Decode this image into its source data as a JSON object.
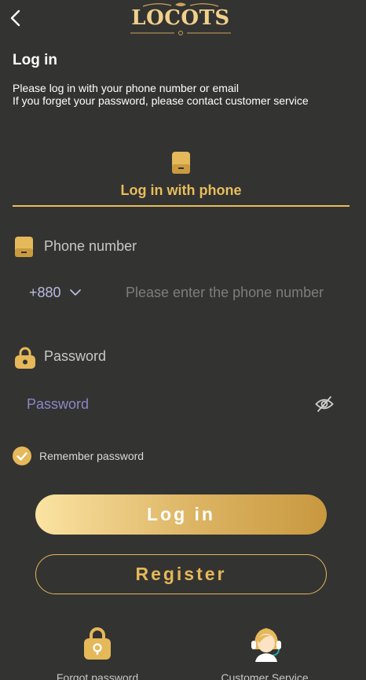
{
  "header": {
    "logo_text": "LOCOTS"
  },
  "title": "Log in",
  "subtitle": {
    "line1": "Please log in with your phone number or email",
    "line2": "If you forget your password, please contact customer service"
  },
  "tab": {
    "label": "Log in with phone",
    "icon": "phone-icon"
  },
  "phone": {
    "label": "Phone number",
    "country_code": "+880",
    "placeholder": "Please enter the phone number"
  },
  "password": {
    "label": "Password",
    "placeholder": "Password"
  },
  "remember": {
    "label": "Remember password",
    "checked": true
  },
  "buttons": {
    "login": "Log in",
    "register": "Register"
  },
  "bottom": {
    "forgot": "Forgot password",
    "service": "Customer Service"
  },
  "colors": {
    "background": "#333331",
    "accent": "#e5b85a",
    "placeholder": "#8c86c8",
    "country_code": "#b8bce0"
  }
}
